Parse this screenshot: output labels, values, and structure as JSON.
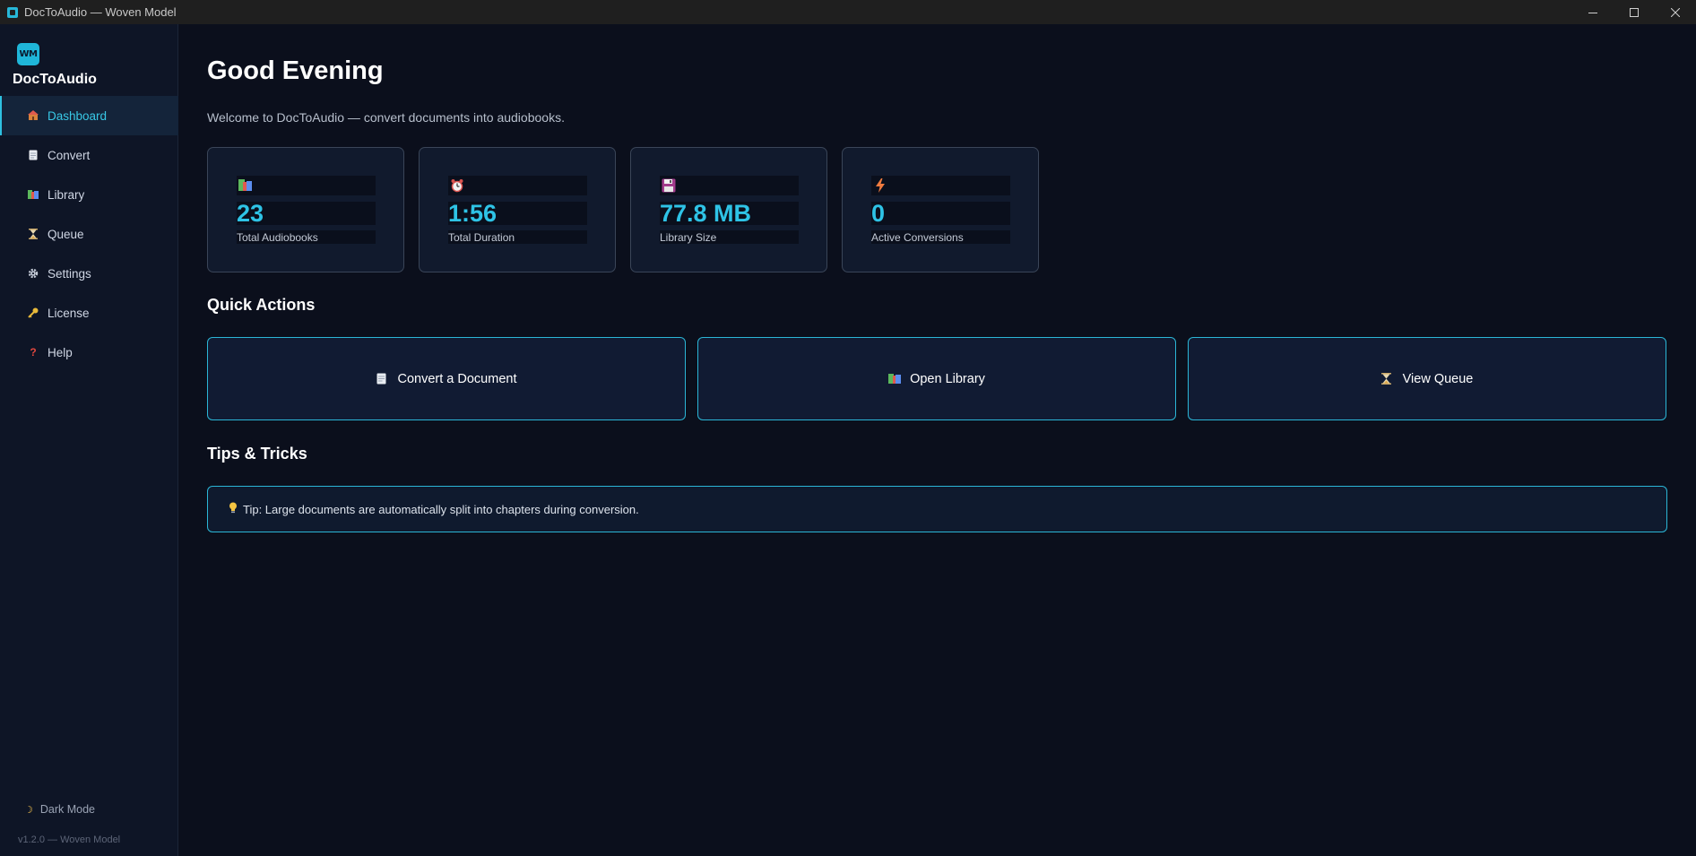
{
  "window": {
    "title": "DocToAudio — Woven Model"
  },
  "sidebar": {
    "logo_text": "WM",
    "brand": "DocToAudio",
    "items": [
      {
        "label": "Dashboard",
        "icon": "dashboard-icon",
        "active": true
      },
      {
        "label": "Convert",
        "icon": "document-icon",
        "active": false
      },
      {
        "label": "Library",
        "icon": "books-icon",
        "active": false
      },
      {
        "label": "Queue",
        "icon": "hourglass-icon",
        "active": false
      },
      {
        "label": "Settings",
        "icon": "gear-icon",
        "active": false
      },
      {
        "label": "License",
        "icon": "key-icon",
        "active": false
      },
      {
        "label": "Help",
        "icon": "question-icon",
        "active": false
      }
    ],
    "dark_mode_label": "Dark Mode",
    "version": "v1.2.0 — Woven Model"
  },
  "main": {
    "greeting": "Good Evening",
    "welcome": "Welcome to DocToAudio — convert documents into audiobooks.",
    "stats": [
      {
        "value": "23",
        "label": "Total Audiobooks",
        "icon": "books-icon"
      },
      {
        "value": "1:56",
        "label": "Total Duration",
        "icon": "alarm-clock-icon"
      },
      {
        "value": "77.8 MB",
        "label": "Library Size",
        "icon": "floppy-disk-icon"
      },
      {
        "value": "0",
        "label": "Active Conversions",
        "icon": "lightning-icon"
      }
    ],
    "quick_actions_title": "Quick Actions",
    "quick_actions": [
      {
        "label": "Convert a Document",
        "icon": "document-icon"
      },
      {
        "label": "Open Library",
        "icon": "books-icon"
      },
      {
        "label": "View Queue",
        "icon": "hourglass-icon"
      }
    ],
    "tips_title": "Tips & Tricks",
    "tip": "Tip: Large documents are automatically split into chapters during conversion."
  },
  "colors": {
    "accent": "#2ec3e6",
    "background": "#0b0f1c",
    "sidebar": "#0e1526"
  }
}
